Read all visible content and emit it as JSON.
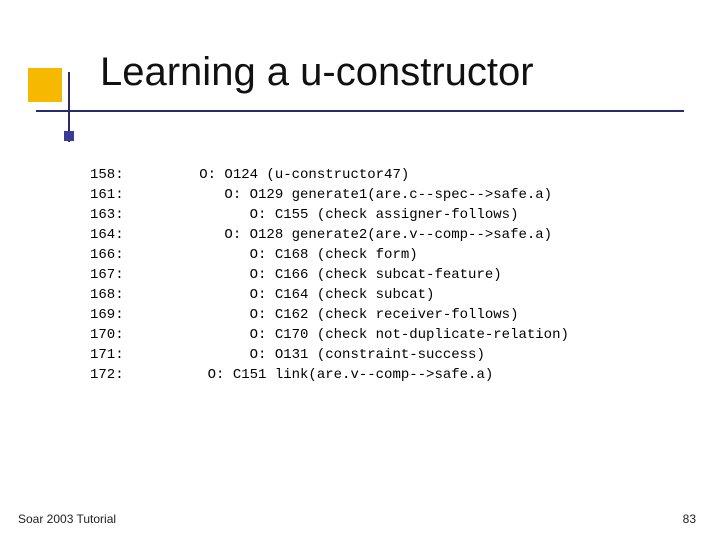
{
  "title": "Learning a u-constructor",
  "footer": {
    "left": "Soar 2003 Tutorial",
    "page": "83"
  },
  "trace": {
    "lines": [
      "158:         O: O124 (u-constructor47)",
      "161:            O: O129 generate1(are.c--spec-->safe.a)",
      "163:               O: C155 (check assigner-follows)",
      "164:            O: O128 generate2(are.v--comp-->safe.a)",
      "166:               O: C168 (check form)",
      "167:               O: C166 (check subcat-feature)",
      "168:               O: C164 (check subcat)",
      "169:               O: C162 (check receiver-follows)",
      "170:               O: C170 (check not-duplicate-relation)",
      "171:               O: O131 (constraint-success)",
      "172:          O: C151 link(are.v--comp-->safe.a)"
    ]
  }
}
